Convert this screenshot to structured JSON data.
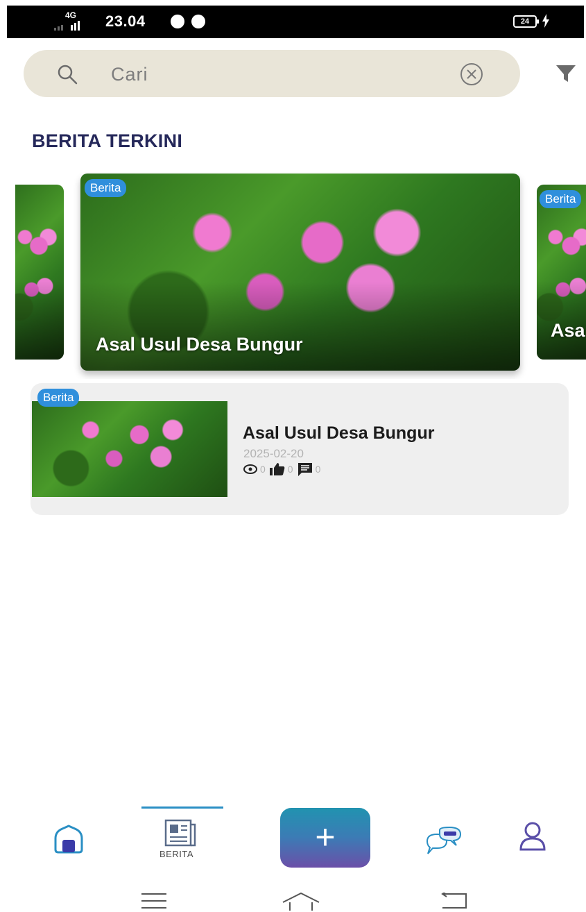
{
  "status_bar": {
    "network": "4G",
    "time": "23.04",
    "battery": "24"
  },
  "search": {
    "placeholder": "Cari"
  },
  "section": {
    "title": "BERITA TERKINI"
  },
  "carousel": {
    "slides": [
      {
        "badge": "Berita",
        "title": "Asal Usul Desa Bungur"
      },
      {
        "badge": "Berita",
        "title": "Asa"
      }
    ]
  },
  "news": [
    {
      "badge": "Berita",
      "title": "Asal Usul Desa Bungur",
      "date": "2025-02-20",
      "views": "0",
      "likes": "0",
      "comments": "0"
    }
  ],
  "bottom_nav": {
    "berita_label": "BERITA",
    "add_label": "+"
  },
  "colors": {
    "accent": "#2a8fc4",
    "section_title": "#25285a",
    "badge": "#2f8fdc",
    "search_bg": "#e9e5d8"
  }
}
